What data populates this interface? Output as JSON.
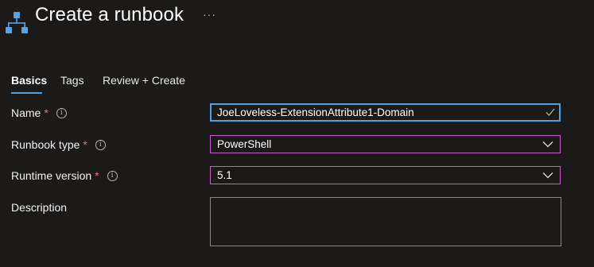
{
  "header": {
    "title": "Create a runbook",
    "more_label": "···",
    "icon": "runbook-hierarchy-icon"
  },
  "tabs": [
    {
      "label": "Basics",
      "active": true
    },
    {
      "label": "Tags",
      "active": false
    },
    {
      "label": "Review + Create",
      "active": false
    }
  ],
  "form": {
    "name": {
      "label": "Name",
      "required_mark": "*",
      "info_glyph": "i",
      "value": "JoeLoveless-ExtensionAttribute1-Domain",
      "valid": true
    },
    "runbook_type": {
      "label": "Runbook type",
      "required_mark": "*",
      "info_glyph": "i",
      "value": "PowerShell"
    },
    "runtime_version": {
      "label": "Runtime version",
      "required_mark": "*",
      "info_glyph": "i",
      "value": "5.1"
    },
    "description": {
      "label": "Description",
      "value": ""
    }
  },
  "colors": {
    "background": "#1b1a19",
    "accent": "#4f9fe6",
    "select_border": "#c95ed0",
    "required": "#f1707b",
    "valid_check": "#8fbf7a"
  }
}
